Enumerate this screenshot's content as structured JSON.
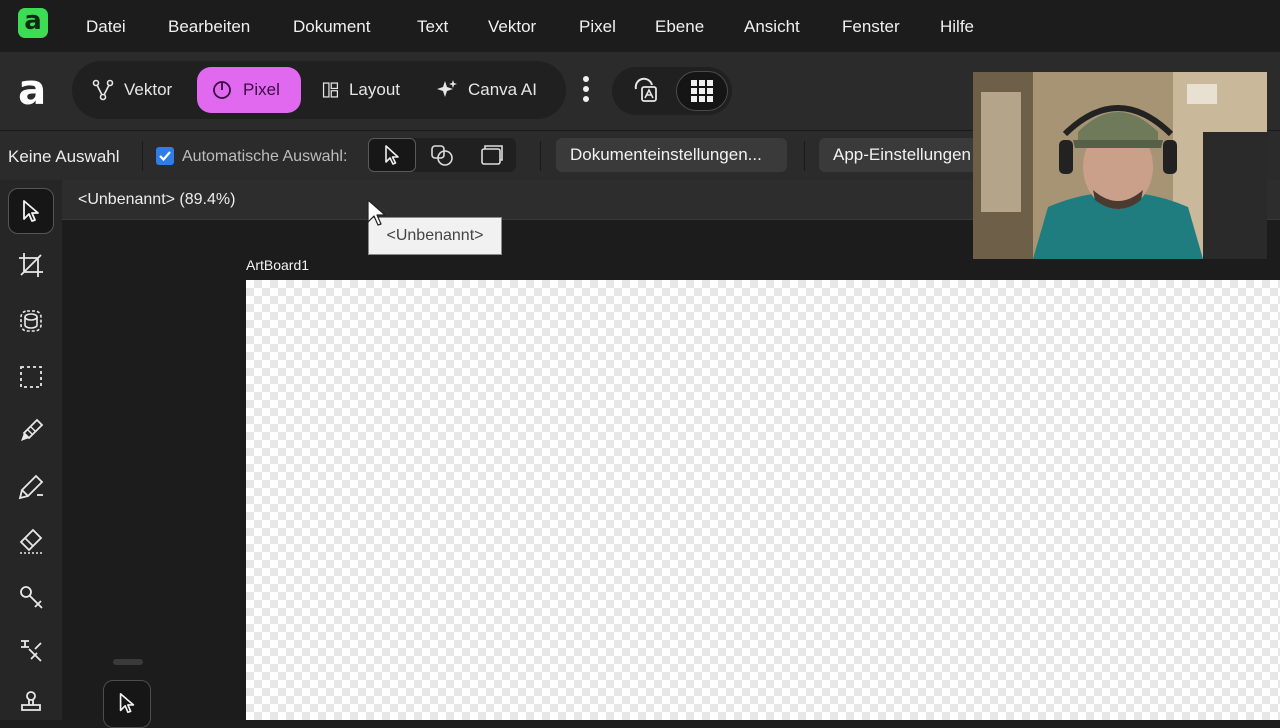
{
  "app": {
    "logo_letter": "a",
    "brand_letter": "a"
  },
  "menu": [
    "Datei",
    "Bearbeiten",
    "Dokument",
    "Text",
    "Vektor",
    "Pixel",
    "Ebene",
    "Ansicht",
    "Fenster",
    "Hilfe"
  ],
  "personas": {
    "vektor": "Vektor",
    "pixel": "Pixel",
    "layout": "Layout",
    "canva_ai": "Canva AI",
    "active": "Pixel",
    "active_color": "#e069f0"
  },
  "context": {
    "selection": "Keine Auswahl",
    "auto_select_label": "Automatische Auswahl:",
    "auto_select_checked": true,
    "document_settings": "Dokumenteinstellungen...",
    "app_settings": "App-Einstellungen"
  },
  "document": {
    "title": "<Unbenannt> (89.4%)",
    "artboard": "ArtBoard1",
    "tooltip": "<Unbenannt>"
  },
  "tools": [
    "move-tool-icon",
    "crop-tool-icon",
    "selection-brush-icon",
    "marquee-icon",
    "paint-brush-icon",
    "pencil-icon",
    "eraser-icon",
    "dodge-icon",
    "burn-icon",
    "clone-stamp-icon"
  ],
  "colors": {
    "accent_pink": "#e069f0",
    "check_blue": "#2f7de8",
    "logo_green": "#3ddc55"
  }
}
